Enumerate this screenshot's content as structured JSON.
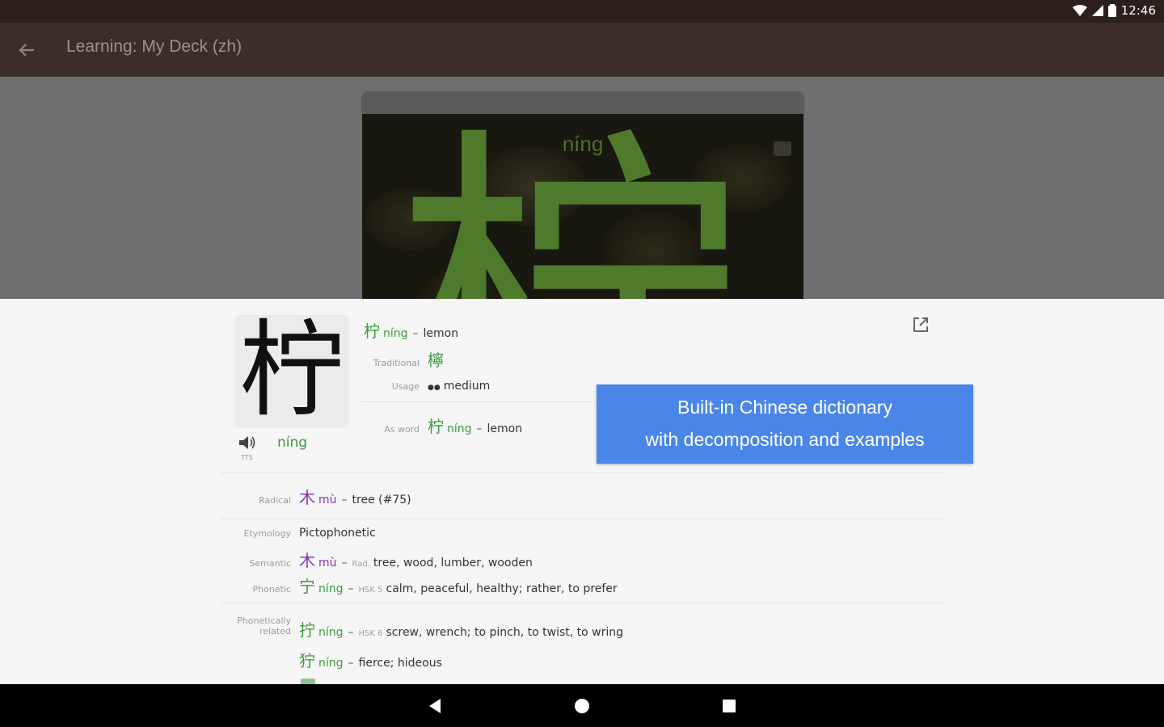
{
  "status_bar": {
    "time": "12:46"
  },
  "app_bar": {
    "title": "Learning: My Deck (zh)"
  },
  "card": {
    "pinyin": "níng",
    "hanzi": "柠"
  },
  "entry": {
    "char": "柠",
    "pinyin": "níng",
    "tts_label": "TTS",
    "headword": {
      "hanzi": "柠",
      "pinyin": "níng",
      "meaning": "lemon"
    },
    "traditional": {
      "label": "Traditional",
      "hanzi": "檸"
    },
    "usage": {
      "label": "Usage",
      "dots": "●●",
      "value": "medium"
    },
    "as_word": {
      "label": "As word",
      "hanzi": "柠",
      "pinyin": "níng",
      "meaning": "lemon"
    },
    "radical": {
      "label": "Radical",
      "hanzi": "木",
      "pinyin": "mù",
      "meaning": "tree (#75)"
    },
    "etymology": {
      "label": "Etymology",
      "value": "Pictophonetic"
    },
    "semantic": {
      "label": "Semantic",
      "hanzi": "木",
      "pinyin": "mù",
      "tag": "Rad.",
      "meaning": "tree, wood, lumber, wooden"
    },
    "phonetic": {
      "label": "Phonetic",
      "hanzi": "宁",
      "pinyin": "níng",
      "tag": "HSK 5",
      "meaning": "calm, peaceful, healthy; rather, to prefer"
    },
    "phonetically_related": {
      "label_line1": "Phonetically",
      "label_line2": "related",
      "items": [
        {
          "hanzi": "拧",
          "pinyin": "níng",
          "tag": "HSK 6",
          "meaning": "screw, wrench; to pinch, to twist, to wring"
        },
        {
          "hanzi": "狞",
          "pinyin": "níng",
          "tag": "",
          "meaning": "fierce; hideous"
        }
      ]
    }
  },
  "banner": {
    "line1": "Built-in Chinese dictionary",
    "line2": "with decomposition and examples"
  },
  "colors": {
    "accent_green": "#3d9a3d",
    "radical_purple": "#8a2fb3",
    "banner_blue": "#4a86e8",
    "app_bar": "#3d2d28"
  }
}
